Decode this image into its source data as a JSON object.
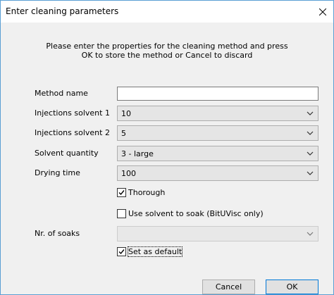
{
  "dialog": {
    "title": "Enter cleaning parameters",
    "intro_line1": "Please enter the properties for the cleaning method and press",
    "intro_line2": "OK to store the method or Cancel to discard"
  },
  "fields": {
    "method_name": {
      "label": "Method name",
      "value": ""
    },
    "injections_solvent_1": {
      "label": "Injections solvent 1",
      "value": "10"
    },
    "injections_solvent_2": {
      "label": "Injections solvent 2",
      "value": "5"
    },
    "solvent_quantity": {
      "label": "Solvent quantity",
      "value": "3 - large"
    },
    "drying_time": {
      "label": "Drying time",
      "value": "100"
    },
    "nr_of_soaks": {
      "label": "Nr. of soaks",
      "value": ""
    }
  },
  "checkboxes": {
    "thorough": {
      "label": "Thorough",
      "checked": true
    },
    "use_solvent_to_soak": {
      "label": "Use solvent to soak (BitUVisc only)",
      "checked": false
    },
    "set_as_default": {
      "label": "Set as default",
      "checked": true
    }
  },
  "buttons": {
    "cancel": "Cancel",
    "ok": "OK"
  },
  "icons": {
    "close": "close-icon",
    "dropdown": "chevron-down-icon",
    "check": "checkmark-icon"
  },
  "colors": {
    "window_border": "#5a9fd4",
    "dialog_background": "#f0f0f0",
    "default_button_border": "#0078d7"
  }
}
